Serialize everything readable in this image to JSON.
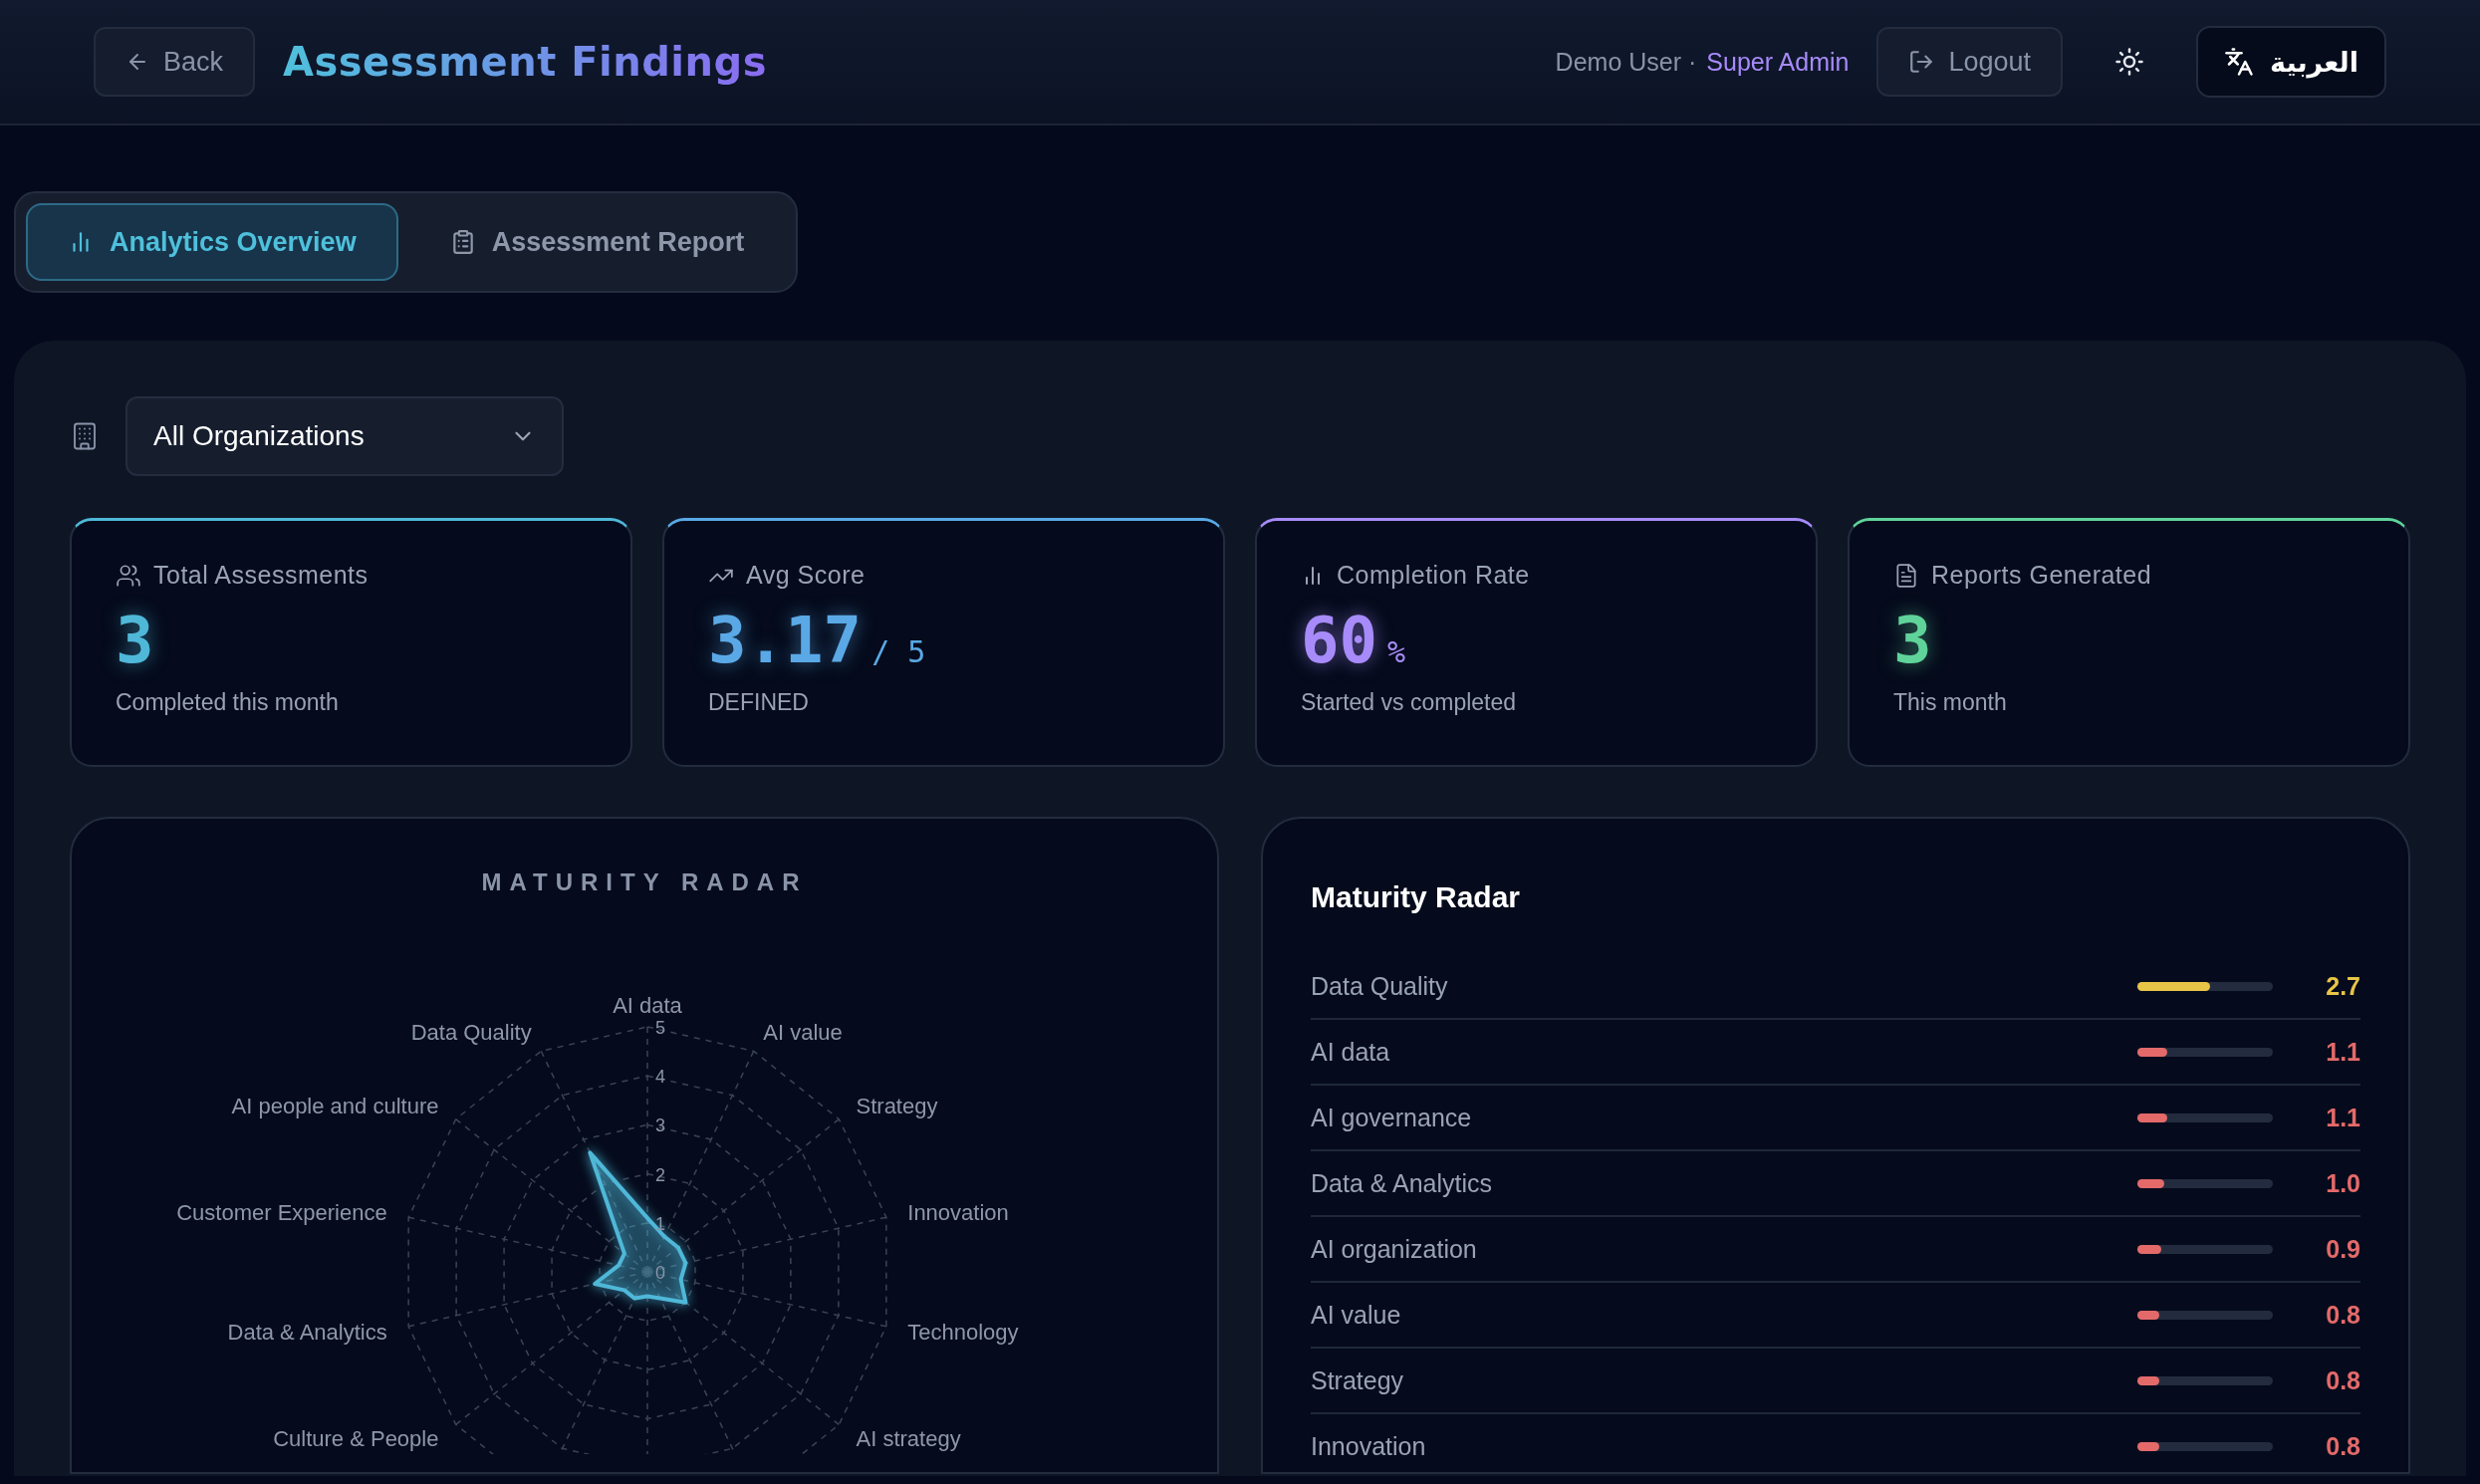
{
  "header": {
    "back": "Back",
    "title": "Assessment Findings",
    "user": "Demo User ·",
    "role": "Super Admin",
    "logout": "Logout",
    "language": "العربية"
  },
  "tabs": [
    {
      "label": "Analytics Overview",
      "selected": true,
      "kind": "chart"
    },
    {
      "label": "Assessment Report",
      "selected": false,
      "kind": "clipboard"
    }
  ],
  "filter": {
    "value": "All Organizations"
  },
  "stats": [
    {
      "kind": "users",
      "label": "Total Assessments",
      "value": "3",
      "note": "Completed this month",
      "color": "#4fb8d8"
    },
    {
      "kind": "trend",
      "label": "Avg Score",
      "value": "3.17",
      "suffix": "/ 5",
      "note": "DEFINED",
      "color": "#5aa9e6"
    },
    {
      "kind": "chart",
      "label": "Completion Rate",
      "value": "60",
      "suffix": "%",
      "note": "Started vs completed",
      "color": "#a78bfa"
    },
    {
      "kind": "file",
      "label": "Reports Generated",
      "value": "3",
      "note": "This month",
      "color": "#5fd39a"
    }
  ],
  "radar": {
    "title": "MATURITY RADAR",
    "ticks": [
      "5",
      "4",
      "3",
      "2",
      "1",
      "0"
    ],
    "axes_right": [
      "AI data",
      "AI value",
      "Strategy",
      "Innovation",
      "Technology",
      "AI strategy"
    ],
    "axes_left": [
      "Data Quality",
      "AI people and culture",
      "Customer Experience",
      "Data & Analytics",
      "Culture & People"
    ]
  },
  "scores": {
    "title": "Maturity Radar",
    "rows": [
      {
        "name": "Data Quality",
        "score": "2.7",
        "level": 0.54,
        "color": "#e8c547"
      },
      {
        "name": "AI data",
        "score": "1.1",
        "level": 0.22,
        "color": "#e46a6a"
      },
      {
        "name": "AI governance",
        "score": "1.1",
        "level": 0.22,
        "color": "#e46a6a"
      },
      {
        "name": "Data & Analytics",
        "score": "1.0",
        "level": 0.2,
        "color": "#e46a6a"
      },
      {
        "name": "AI organization",
        "score": "0.9",
        "level": 0.18,
        "color": "#e46a6a"
      },
      {
        "name": "AI value",
        "score": "0.8",
        "level": 0.16,
        "color": "#e46a6a"
      },
      {
        "name": "Strategy",
        "score": "0.8",
        "level": 0.16,
        "color": "#e46a6a"
      },
      {
        "name": "Innovation",
        "score": "0.8",
        "level": 0.16,
        "color": "#e46a6a"
      }
    ]
  }
}
